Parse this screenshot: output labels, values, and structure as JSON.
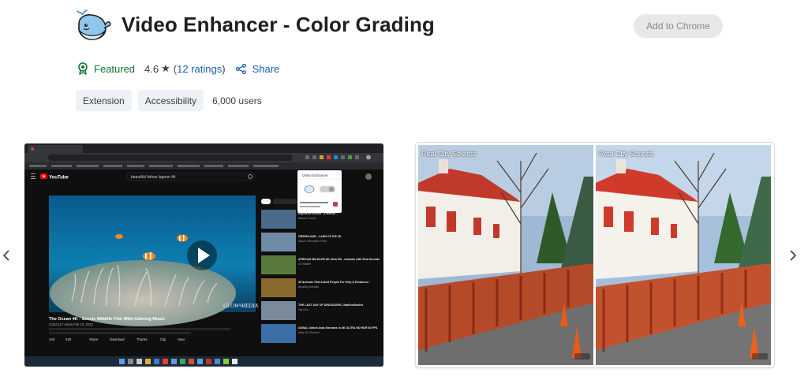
{
  "header": {
    "title": "Video Enhancer - Color Grading",
    "add_button": "Add to Chrome"
  },
  "meta": {
    "featured": "Featured",
    "rating": "4.6",
    "star": "★",
    "ratings_link": "12 ratings",
    "share": "Share"
  },
  "chips": {
    "type": "Extension",
    "category": "Accessibility",
    "users": "6,000 users"
  },
  "screenshot1": {
    "search": "beautiful fishes lagoon 4k",
    "video_title": "The Ocean 4K - Scenic Wildlife Film With Calming Music",
    "video_stats": "3,043,117 views  Feb 12, 2022",
    "popup_title": "Video Enhancer",
    "actions": [
      "14K",
      "439",
      "Share",
      "Download",
      "Thanks",
      "Clip",
      "Save"
    ],
    "watermark": "GLOW•MEDIA",
    "sidebar": [
      {
        "title": "Explosive Bloom - A MAGIC...",
        "meta": "Mission Sound"
      },
      {
        "title": "GREENLAND - LAND OF ICE 4K",
        "meta": "Nature Relaxation Films"
      },
      {
        "title": "AFRICAN WILDLIFE 8K Ultra HD - Animals with Real Sounds",
        "meta": "4K Wildlife"
      },
      {
        "title": "30 Animals That Asked People For Help & Kindness !",
        "meta": "Amazing Animals"
      },
      {
        "title": "THE LAST DAY OF DINOSAURS | NatGeoStories",
        "meta": "Nat Geo"
      },
      {
        "title": "DUBAI, United Arab Emirates in 8K ULTRA HD HDR 60 FPS",
        "meta": "Ultra HD Channel"
      }
    ]
  },
  "screenshot2": {
    "label_left": "Real City Sounds",
    "label_right": "Real City Sounds"
  },
  "colors": {
    "featured_green": "#137333",
    "link_blue": "#1a5fb4",
    "chip_bg": "#eef1f6"
  }
}
